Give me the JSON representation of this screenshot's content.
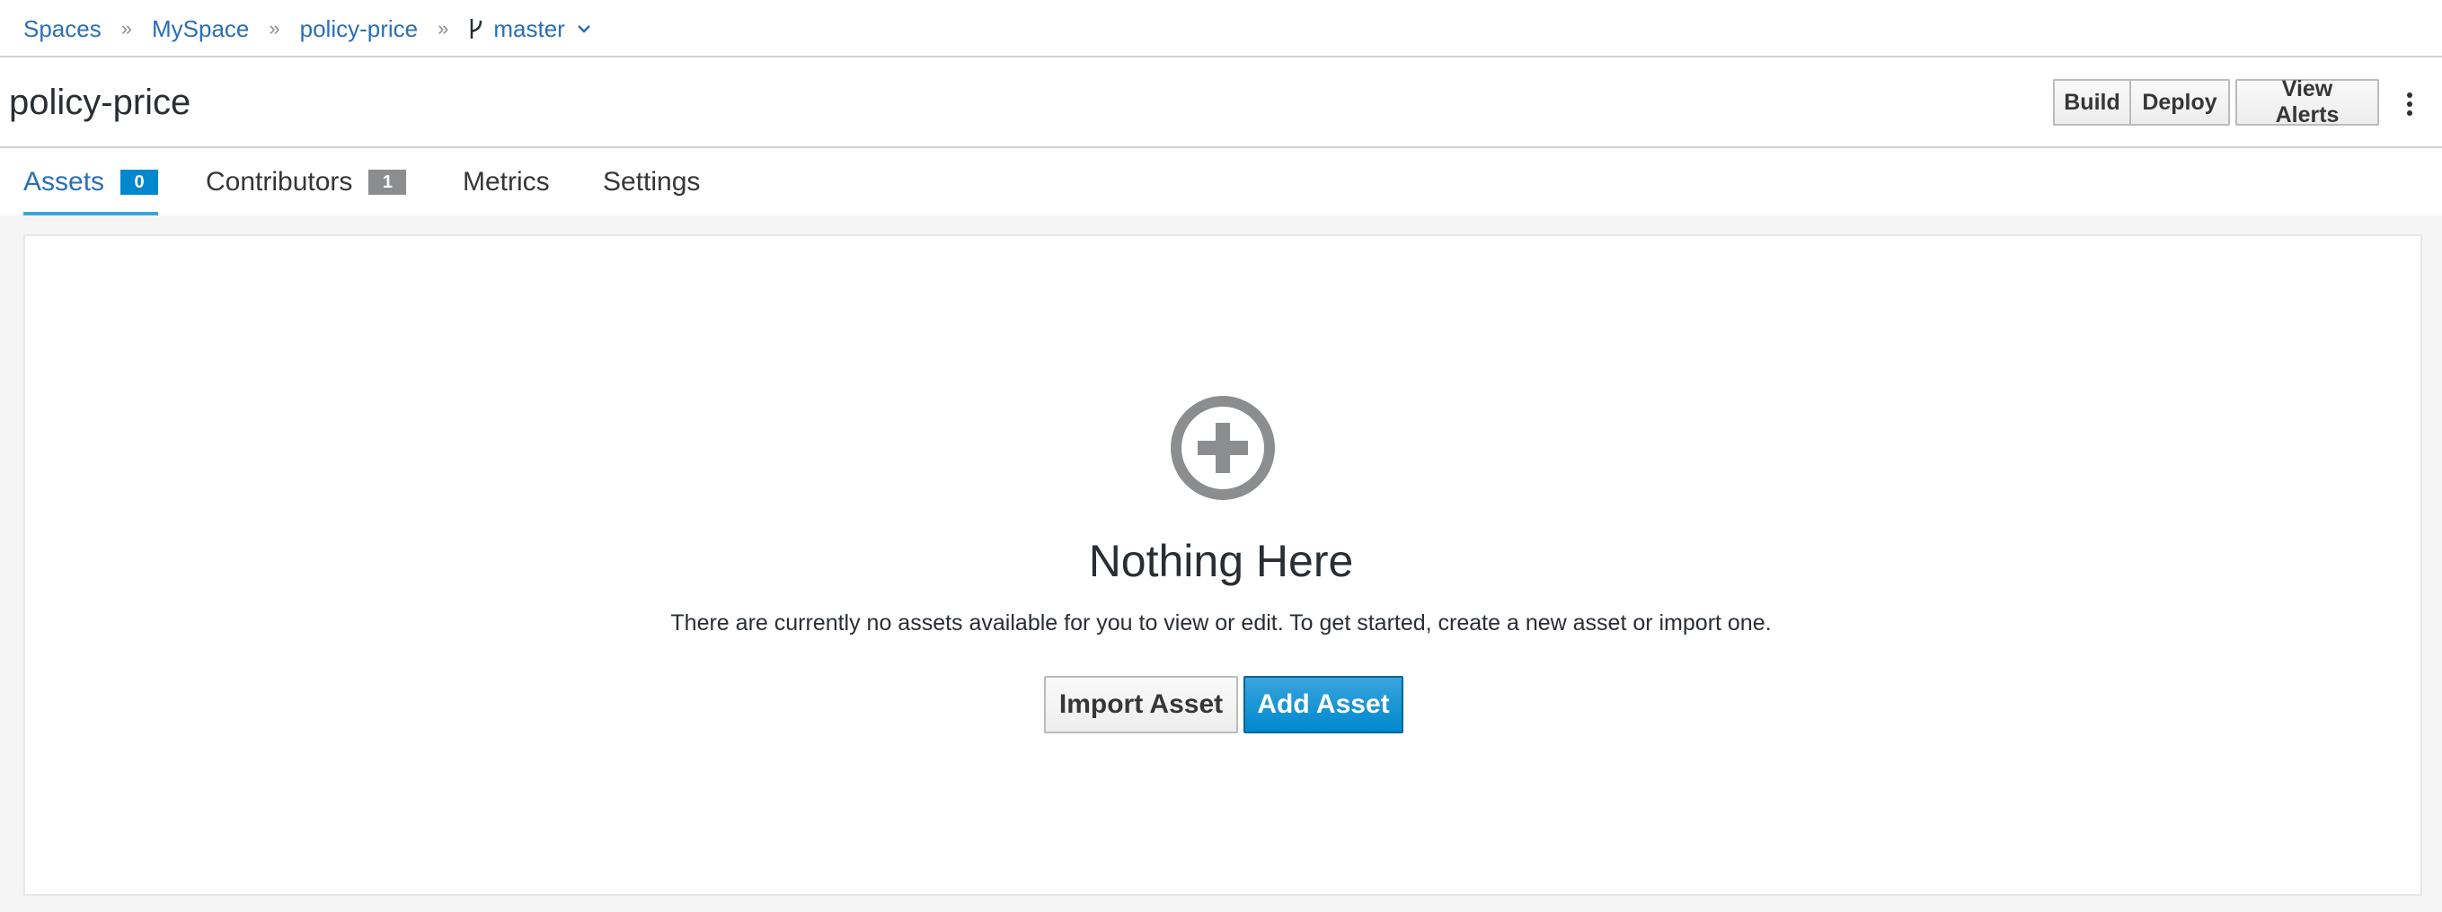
{
  "breadcrumb": {
    "items": [
      "Spaces",
      "MySpace",
      "policy-price"
    ],
    "branch": "master",
    "separator": "»"
  },
  "header": {
    "title": "policy-price",
    "build_label": "Build",
    "deploy_label": "Deploy",
    "view_alerts_label": "View Alerts"
  },
  "tabs": [
    {
      "label": "Assets",
      "badge": "0",
      "active": true
    },
    {
      "label": "Contributors",
      "badge": "1",
      "active": false
    },
    {
      "label": "Metrics",
      "active": false
    },
    {
      "label": "Settings",
      "active": false
    }
  ],
  "empty_state": {
    "icon": "add-circle-icon",
    "title": "Nothing Here",
    "text": "There are currently no assets available for you to view or edit. To get started, create a new asset or import one.",
    "import_label": "Import Asset",
    "add_label": "Add Asset"
  },
  "colors": {
    "link": "#2a6fb6",
    "primary": "#0088ce",
    "active_tab_underline": "#39a5dc",
    "badge_gray": "#8b8d8f"
  }
}
